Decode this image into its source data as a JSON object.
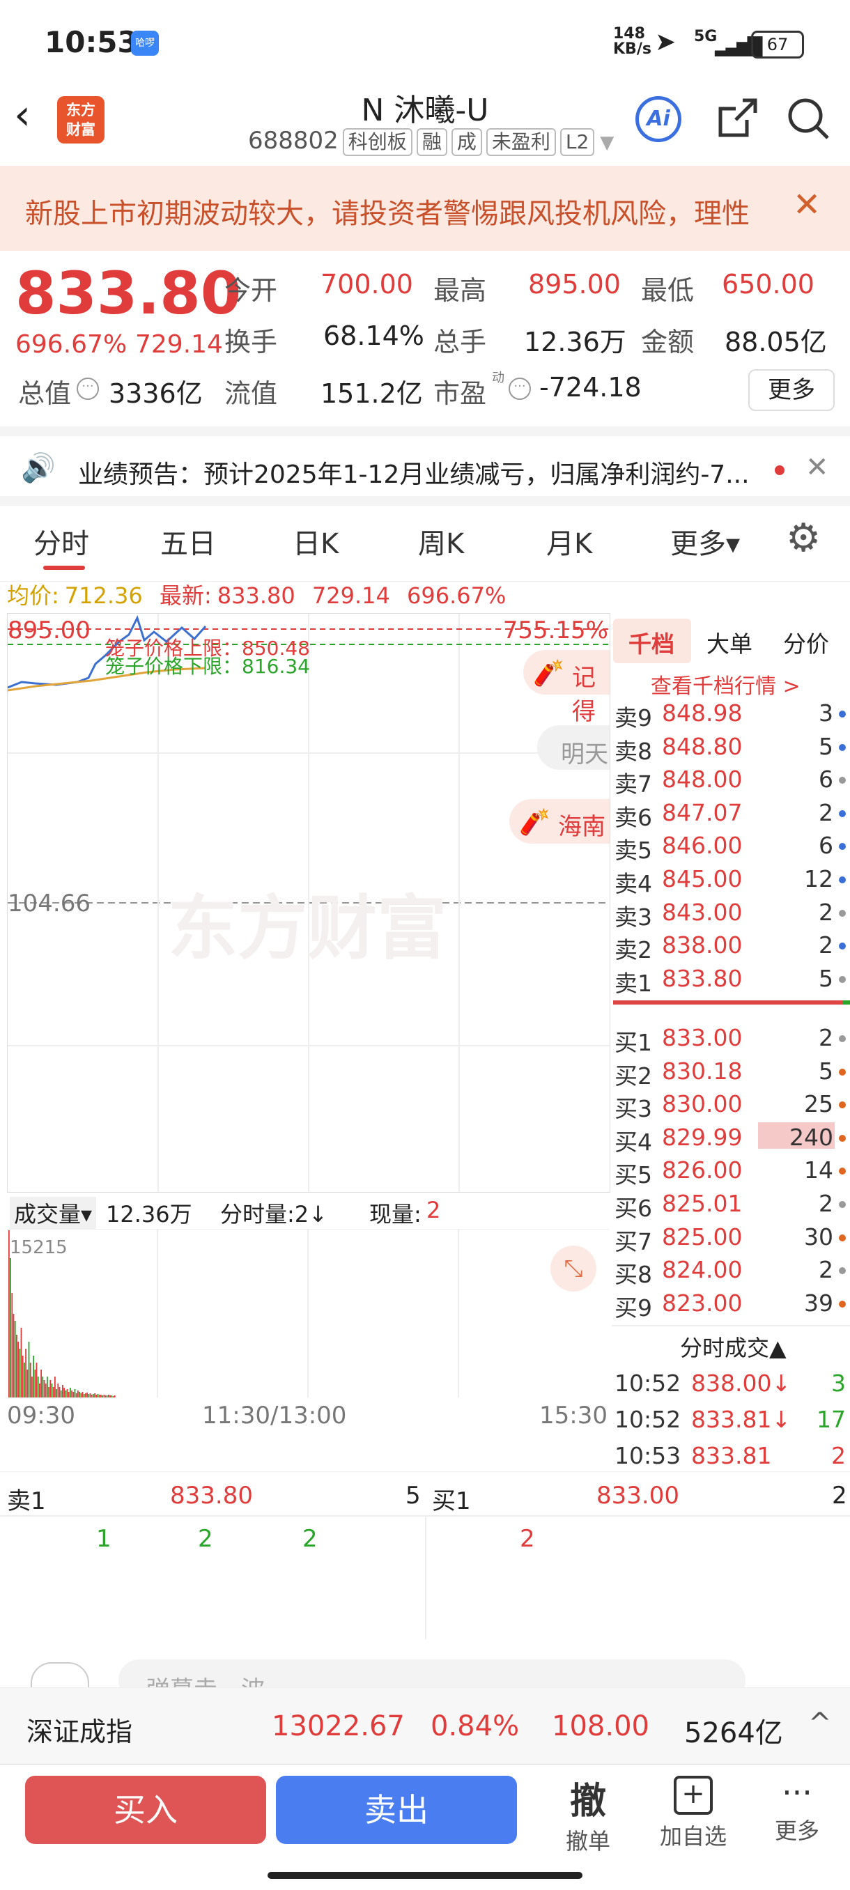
{
  "status": {
    "time": "10:53",
    "app_badge": "哈啰",
    "net_speed_top": "148",
    "net_speed_bottom": "KB/s",
    "network": "5G",
    "battery": "67"
  },
  "header": {
    "logo_line1": "东方",
    "logo_line2": "财富",
    "stock_name": "N 沐曦-U",
    "code": "688802",
    "tags": [
      "科创板",
      "融",
      "成",
      "未盈利",
      "L2"
    ]
  },
  "warning": {
    "text": "新股上市初期波动较大，请投资者警惕跟风投机风险，理性"
  },
  "quote": {
    "price": "833.80",
    "change_pct": "696.67%",
    "change_amt": "729.14",
    "open_label": "今开",
    "open": "700.00",
    "high_label": "最高",
    "high": "895.00",
    "low_label": "最低",
    "low": "650.00",
    "turnover_label": "换手",
    "turnover": "68.14%",
    "volume_label": "总手",
    "volume": "12.36万",
    "amount_label": "金额",
    "amount": "88.05亿",
    "mktcap_label": "总值",
    "mktcap": "3336亿",
    "float_label": "流值",
    "float": "151.2亿",
    "pe_label": "市盈",
    "pe_sup": "动",
    "pe": "-724.18",
    "more_label": "更多"
  },
  "notice": {
    "text": "业绩预告：预计2025年1-12月业绩减亏，归属净利润约-7..."
  },
  "tabs": [
    "分时",
    "五日",
    "日K",
    "周K",
    "月K",
    "更多▾"
  ],
  "infoline": {
    "avg_label": "均价:",
    "avg": "712.36",
    "last_label": "最新:",
    "last": "833.80",
    "chg": "729.14",
    "pct": "696.67%"
  },
  "chart": {
    "y_top": "895.00",
    "pct_top": "755.15%",
    "upper_limit": "笼子价格上限：850.48",
    "lower_limit": "笼子价格下限：816.34",
    "mid": "104.66",
    "watermark": "东方财富",
    "bubble1": "记得",
    "bubble2": "明天",
    "bubble3": "海南"
  },
  "orderbook": {
    "tabs": [
      "千档",
      "大单",
      "分价"
    ],
    "view_link": "查看千档行情 >",
    "asks": [
      {
        "label": "卖9",
        "price": "848.98",
        "vol": "3",
        "dot": "#3a6fd8"
      },
      {
        "label": "卖8",
        "price": "848.80",
        "vol": "5",
        "dot": "#3a6fd8"
      },
      {
        "label": "卖7",
        "price": "848.00",
        "vol": "6",
        "dot": "#999999"
      },
      {
        "label": "卖6",
        "price": "847.07",
        "vol": "2",
        "dot": "#3a6fd8"
      },
      {
        "label": "卖5",
        "price": "846.00",
        "vol": "6",
        "dot": "#3a6fd8"
      },
      {
        "label": "卖4",
        "price": "845.00",
        "vol": "12",
        "dot": "#3a6fd8"
      },
      {
        "label": "卖3",
        "price": "843.00",
        "vol": "2",
        "dot": "#999999"
      },
      {
        "label": "卖2",
        "price": "838.00",
        "vol": "2",
        "dot": "#3a6fd8"
      },
      {
        "label": "卖1",
        "price": "833.80",
        "vol": "5",
        "dot": "#999999"
      }
    ],
    "bids": [
      {
        "label": "买1",
        "price": "833.00",
        "vol": "2",
        "dot": "#999999"
      },
      {
        "label": "买2",
        "price": "830.18",
        "vol": "5",
        "dot": "#e0661f"
      },
      {
        "label": "买3",
        "price": "830.00",
        "vol": "25",
        "dot": "#e0661f"
      },
      {
        "label": "买4",
        "price": "829.99",
        "vol": "240",
        "dot": "#e0661f"
      },
      {
        "label": "买5",
        "price": "826.00",
        "vol": "14",
        "dot": "#e0661f"
      },
      {
        "label": "买6",
        "price": "825.01",
        "vol": "2",
        "dot": "#999999"
      },
      {
        "label": "买7",
        "price": "825.00",
        "vol": "30",
        "dot": "#e0661f"
      },
      {
        "label": "买8",
        "price": "824.00",
        "vol": "2",
        "dot": "#999999"
      },
      {
        "label": "买9",
        "price": "823.00",
        "vol": "39",
        "dot": "#e0661f"
      }
    ],
    "trades_title": "分时成交▲",
    "trades": [
      {
        "time": "10:52",
        "price": "838.00↓",
        "vol": "3"
      },
      {
        "time": "10:52",
        "price": "833.81↓",
        "vol": "17"
      },
      {
        "time": "10:53",
        "price": "833.81",
        "vol": "2"
      }
    ]
  },
  "volume": {
    "label": "成交量▾",
    "total": "12.36万",
    "ticks_label": "分时量:2↓",
    "now_label": "现量:",
    "now": "2",
    "max": "15215",
    "t_start": "09:30",
    "t_mid": "11:30/13:00",
    "t_end": "15:30"
  },
  "book_row": {
    "sell_label": "卖1",
    "sell_price": "833.80",
    "sell_vol": "5",
    "buy_label": "买1",
    "buy_price": "833.00",
    "buy_vol": "2",
    "left_queue": [
      "1",
      "2",
      "2"
    ],
    "right_queue": [
      "2"
    ]
  },
  "comment": {
    "placeholder": "弹幕走一波"
  },
  "index": {
    "name": "深证成指",
    "value": "13022.67",
    "pct": "0.84%",
    "chg": "108.00",
    "amount": "5264亿"
  },
  "bottom": {
    "buy": "买入",
    "sell": "卖出",
    "cancel_icon": "撤",
    "cancel": "撤单",
    "add": "加自选",
    "more": "更多"
  },
  "colors": {
    "red": "#e03c3c",
    "green": "#2aa52a",
    "buy_btn": "#df5454",
    "sell_btn": "#4a7ef0"
  }
}
